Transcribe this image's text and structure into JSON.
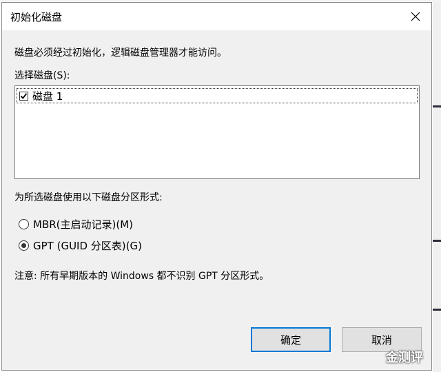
{
  "dialog": {
    "title": "初始化磁盘",
    "description": "磁盘必须经过初始化，逻辑磁盘管理器才能访问。",
    "select_label": "选择磁盘(S):",
    "disks": [
      {
        "label": "磁盘 1",
        "checked": true
      }
    ],
    "partition_label": "为所选磁盘使用以下磁盘分区形式:",
    "partition_options": [
      {
        "label": "MBR(主启动记录)(M)",
        "selected": false
      },
      {
        "label": "GPT (GUID 分区表)(G)",
        "selected": true
      }
    ],
    "note": "注意: 所有早期版本的 Windows 都不识别 GPT 分区形式。",
    "ok_label": "确定",
    "cancel_label": "取消"
  },
  "watermark": "金测评",
  "icons": {
    "close": "close-icon",
    "check": "checkmark-icon"
  },
  "colors": {
    "dialog_bg": "#f0f0f0",
    "titlebar_bg": "#ffffff",
    "button_bg": "#e1e1e1",
    "default_button_border": "#0078d7"
  }
}
